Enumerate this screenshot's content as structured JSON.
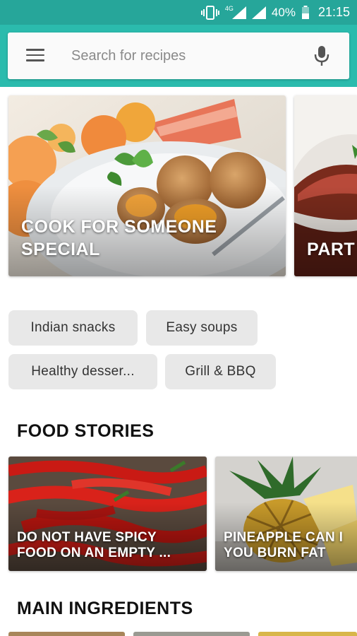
{
  "status_bar": {
    "network": "4G",
    "battery": "40%",
    "time": "21:15"
  },
  "search": {
    "placeholder": "Search for recipes",
    "menu_icon": "menu-icon",
    "mic_icon": "microphone-icon"
  },
  "hero": {
    "cards": [
      {
        "title": "COOK FOR SOMEONE\nSPECIAL"
      },
      {
        "title": "PART"
      }
    ]
  },
  "chips": [
    {
      "label": "Indian snacks"
    },
    {
      "label": "Easy soups"
    },
    {
      "label": "Healthy desser..."
    },
    {
      "label": "Grill & BBQ"
    }
  ],
  "food_stories": {
    "title": "FOOD STORIES",
    "cards": [
      {
        "title": "DO NOT HAVE SPICY\nFOOD ON AN EMPTY ..."
      },
      {
        "title": "PINEAPPLE CAN I\nYOU BURN FAT"
      }
    ]
  },
  "main_ingredients": {
    "title": "MAIN INGREDIENTS"
  },
  "colors": {
    "status_bar": "#26a69a",
    "header": "#2bbbad",
    "chip_bg": "#e8e8e8"
  }
}
